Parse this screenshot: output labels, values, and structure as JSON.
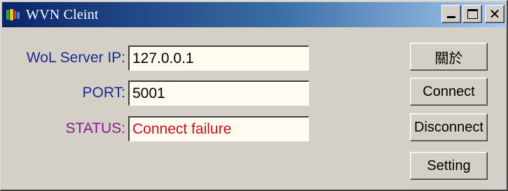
{
  "window": {
    "title": "WVN Cleint",
    "title_icon": "app-icon",
    "controls": {
      "minimize": "minimize-icon",
      "maximize": "maximize-icon",
      "close": "close-icon"
    },
    "colors": {
      "titlebar_start": "#0a246a",
      "titlebar_end": "#a6caf0",
      "face": "#d4d0c8"
    }
  },
  "form": {
    "server_ip_label": "WoL Server IP:",
    "server_ip_value": "127.0.0.1",
    "port_label": "PORT:",
    "port_value": "5001",
    "status_label": "STATUS:",
    "status_value": "Connect failure",
    "colors": {
      "label": "#1a2b8a",
      "status_label": "#8b1a8b",
      "status_value": "#c0101a",
      "field_bg": "#fffbf0"
    }
  },
  "buttons": {
    "about": "關於",
    "connect": "Connect",
    "disconnect": "Disconnect",
    "setting": "Setting"
  },
  "close_glyph": "✕"
}
